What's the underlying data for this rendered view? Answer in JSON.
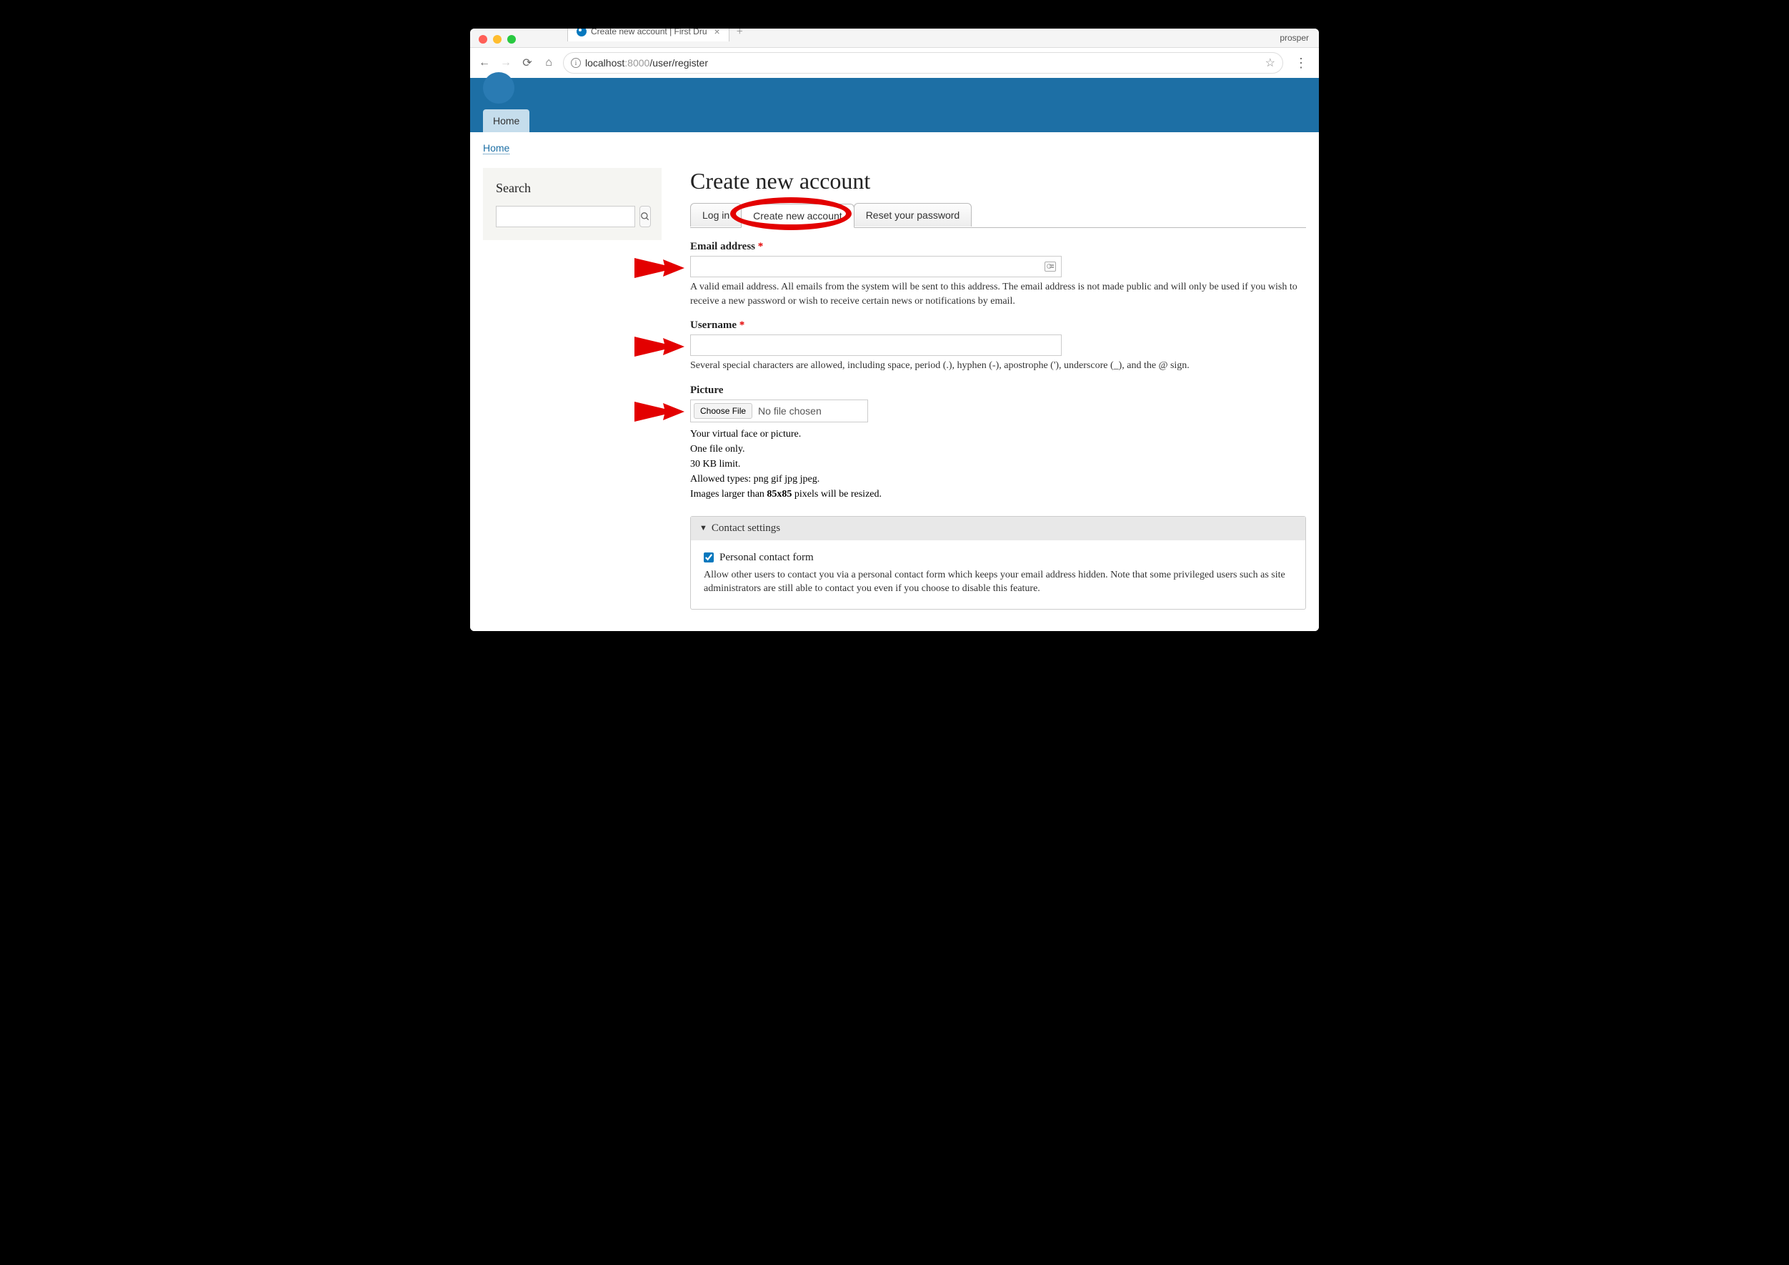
{
  "browser": {
    "tab_title": "Create new account | First Dru",
    "profile": "prosper",
    "url_host": "localhost",
    "url_port": ":8000",
    "url_path": "/user/register"
  },
  "nav": {
    "home": "Home"
  },
  "breadcrumb": {
    "home": "Home"
  },
  "sidebar": {
    "search_title": "Search"
  },
  "page": {
    "title": "Create new account",
    "tabs": {
      "login": "Log in",
      "create": "Create new account",
      "reset": "Reset your password"
    }
  },
  "form": {
    "email_label": "Email address",
    "email_description": "A valid email address. All emails from the system will be sent to this address. The email address is not made public and will only be used if you wish to receive a new password or wish to receive certain news or notifications by email.",
    "username_label": "Username",
    "username_description": "Several special characters are allowed, including space, period (.), hyphen (-), apostrophe ('), underscore (_), and the @ sign.",
    "picture_label": "Picture",
    "choose_file": "Choose File",
    "no_file": "No file chosen",
    "picture_line1": "Your virtual face or picture.",
    "picture_line2": "One file only.",
    "picture_line3": "30 KB limit.",
    "picture_line4": "Allowed types: png gif jpg jpeg.",
    "picture_line5_a": "Images larger than ",
    "picture_line5_b": "85x85",
    "picture_line5_c": " pixels will be resized."
  },
  "contact": {
    "summary": "Contact settings",
    "checkbox_label": "Personal contact form",
    "description": "Allow other users to contact you via a personal contact form which keeps your email address hidden. Note that some privileged users such as site administrators are still able to contact you even if you choose to disable this feature."
  }
}
